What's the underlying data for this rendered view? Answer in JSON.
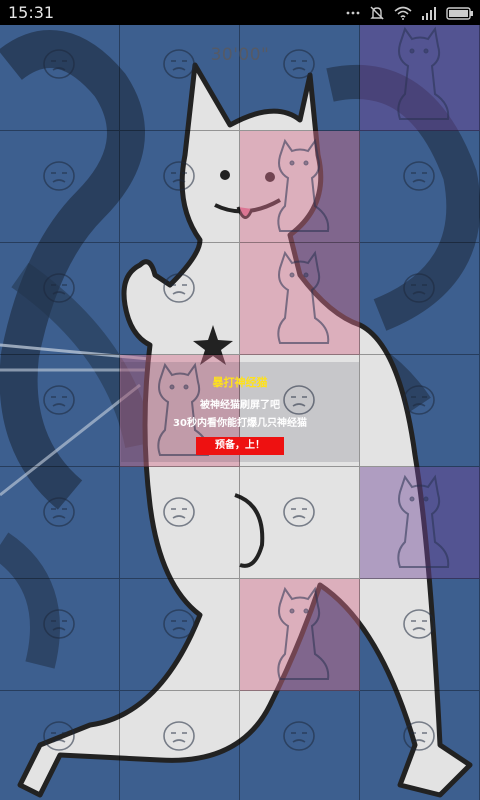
{
  "status_bar": {
    "time": "15:31",
    "icons": [
      "more-dots-icon",
      "silent-icon",
      "wifi-icon",
      "signal-icon",
      "battery-icon"
    ]
  },
  "game": {
    "timer": "30'00\"",
    "grid": {
      "columns": 4,
      "rows": 7
    },
    "dialog": {
      "title": "暴打神经猫",
      "line1": "被神经猫刷屏了吧",
      "line2": "30秒内看你能打爆几只神经猫",
      "start_label": "预备，上！"
    },
    "colors": {
      "background": "#3a5b8a",
      "title": "#ffe21a",
      "button": "#ee1111",
      "cat": "#e4e4e4"
    }
  }
}
